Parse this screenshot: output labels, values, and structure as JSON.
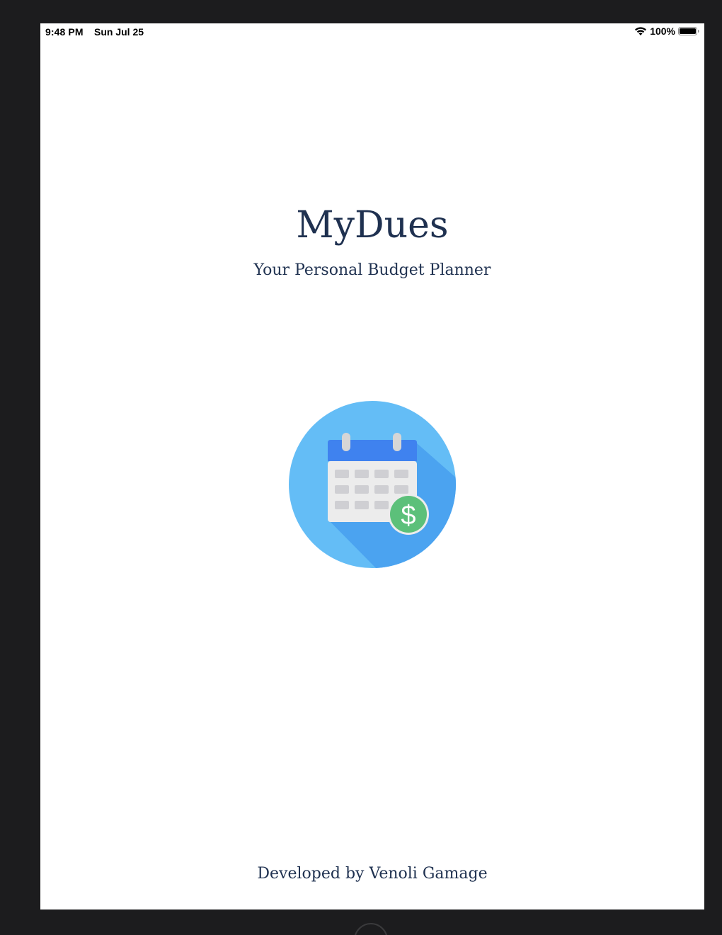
{
  "status_bar": {
    "time": "9:48 PM",
    "date": "Sun Jul 25",
    "battery_percent": "100%",
    "wifi_icon": "wifi-icon",
    "battery_icon": "battery-full-icon"
  },
  "splash": {
    "title": "MyDues",
    "subtitle": "Your Personal Budget Planner",
    "logo_icon": "calendar-dollar-icon",
    "footer": "Developed by Venoli Gamage"
  },
  "colors": {
    "text": "#1f3150",
    "logo_circle": "#64bdf6",
    "logo_shadow": "#4ba3f0",
    "calendar_header": "#3f82ef",
    "calendar_body": "#ececec",
    "dollar_badge": "#5cc07a"
  }
}
